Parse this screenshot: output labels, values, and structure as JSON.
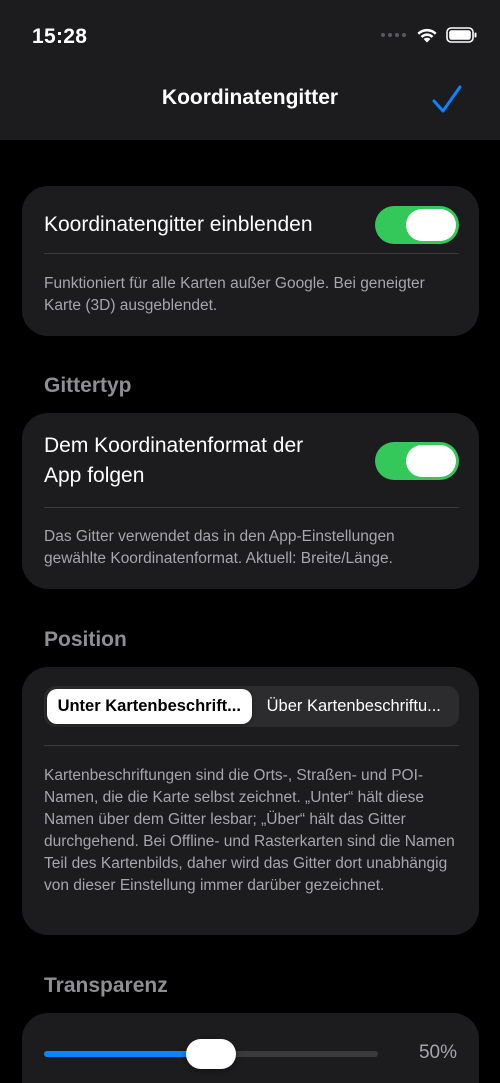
{
  "status_bar": {
    "time": "15:28",
    "icons": [
      "cellular-signal-icon",
      "wifi-icon",
      "battery-icon"
    ]
  },
  "nav": {
    "title": "Koordinatengitter",
    "done_icon": "checkmark-icon",
    "accent_color": "#0a84ff"
  },
  "show_grid": {
    "label": "Koordinatengitter einblenden",
    "enabled": true,
    "footnote": "Funktioniert für alle Karten außer Google. Bei geneigter Karte (3D) ausgeblendet."
  },
  "grid_type": {
    "header": "Gittertyp",
    "label_line1": "Dem Koordinatenformat der",
    "label_line2": "App folgen",
    "enabled": true,
    "footnote": "Das Gitter verwendet das in den App-Einstellungen gewählte Koordinatenformat. Aktuell: Breite/Länge."
  },
  "position": {
    "header": "Position",
    "segments": [
      "Unter Kartenbeschrift...",
      "Über Kartenbeschriftu..."
    ],
    "selected_index": 0,
    "footnote": "Kartenbeschriftungen sind die Orts-, Straßen- und POI-Namen, die die Karte selbst zeichnet. „Unter“ hält diese Namen über dem Gitter lesbar; „Über“ hält das Gitter durchgehend. Bei Offline- und Rasterkarten sind die Namen Teil des Kartenbilds, daher wird das Gitter dort unabhängig von dieser Einstellung immer darüber gezeichnet."
  },
  "transparency": {
    "header": "Transparenz",
    "value": 0.5,
    "value_label": "50%"
  },
  "colors": {
    "toggle_on": "#34c759",
    "background": "#000000",
    "card": "#1c1c1e",
    "secondary_text": "#a6a6ab"
  }
}
